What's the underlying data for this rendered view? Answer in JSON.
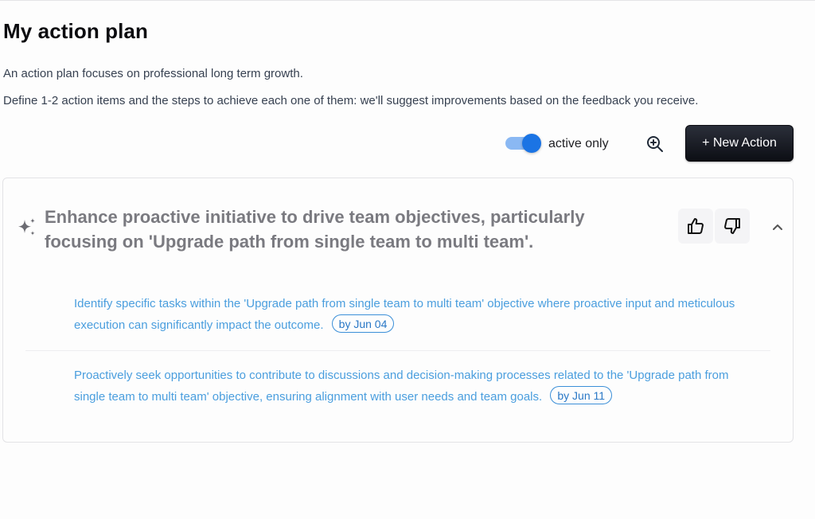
{
  "page": {
    "title": "My action plan",
    "description_1": "An action plan focuses on professional long term growth.",
    "description_2": "Define 1-2 action items and the steps to achieve each one of them: we'll suggest improvements based on the feedback you receive."
  },
  "toolbar": {
    "toggle_label": "active only",
    "toggle_on": true,
    "new_action_label": "+ New Action"
  },
  "action": {
    "title": "Enhance proactive initiative to drive team objectives, particularly focusing on 'Upgrade path from single team to multi team'.",
    "steps": [
      {
        "text": "Identify specific tasks within the 'Upgrade path from single team to multi team' objective where proactive input and meticulous execution can significantly impact the outcome.",
        "due": "by Jun 04"
      },
      {
        "text": "Proactively seek opportunities to contribute to discussions and decision-making processes related to the 'Upgrade path from single team to multi team' objective, ensuring alignment with user needs and team goals.",
        "due": "by Jun 11"
      }
    ]
  },
  "icons": {
    "sparkle": "sparkle-icon",
    "search": "zoom-in-icon",
    "thumbs_up": "thumbs-up-icon",
    "thumbs_down": "thumbs-down-icon",
    "collapse": "chevron-up-icon"
  },
  "colors": {
    "accent": "#1b74e4",
    "step_text": "#4a9ede",
    "button_dark": "#0c0e14"
  }
}
